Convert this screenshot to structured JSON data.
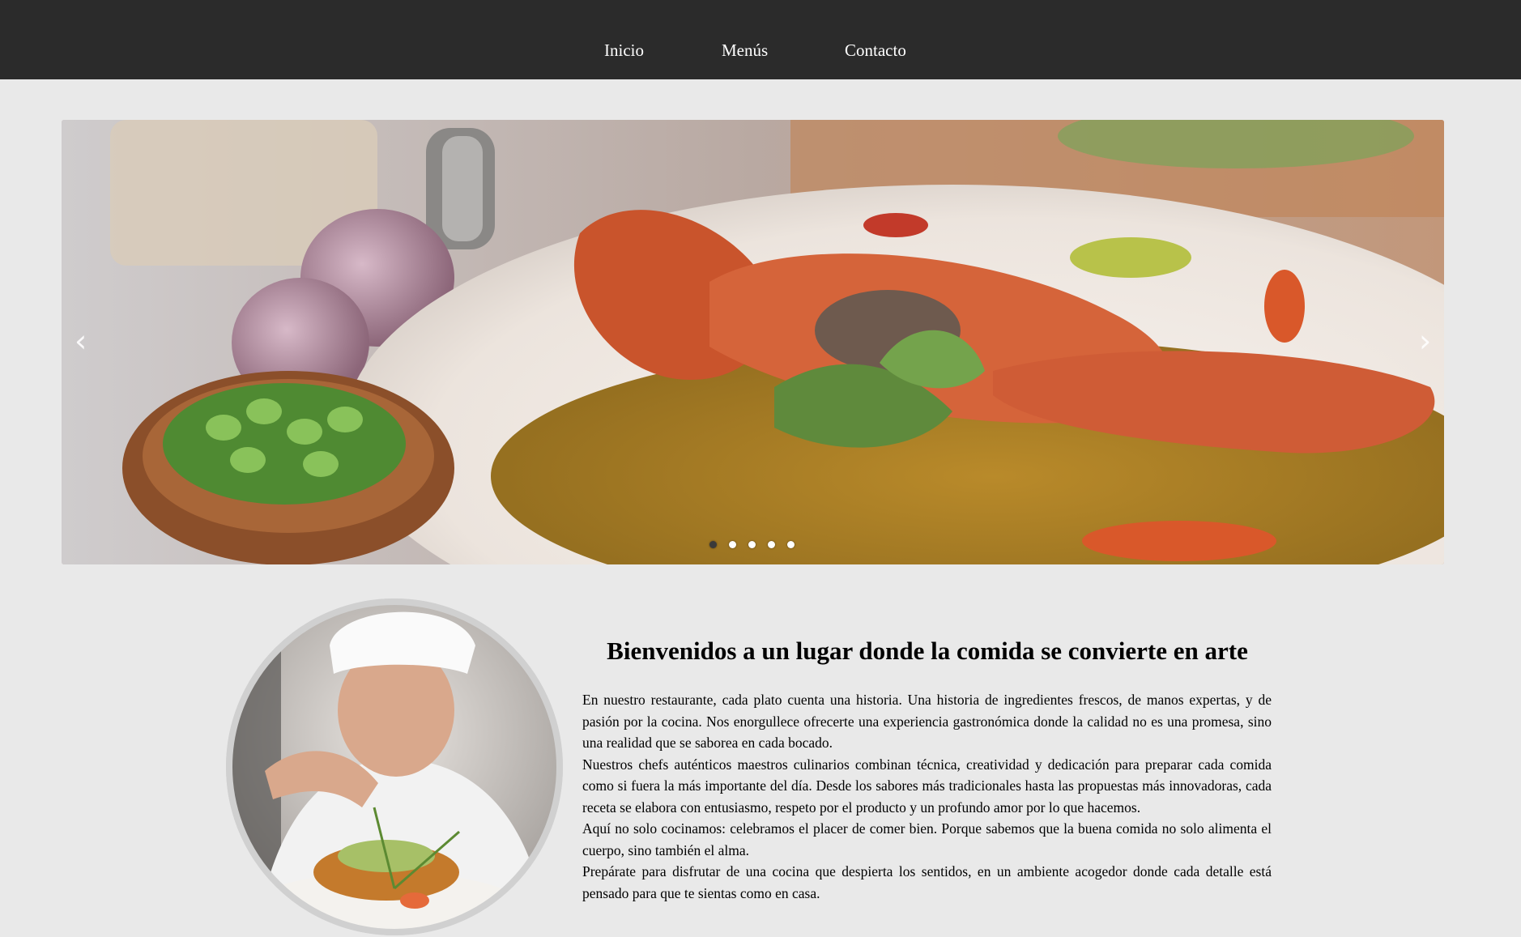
{
  "nav": {
    "items": [
      {
        "label": "Inicio"
      },
      {
        "label": "Menús"
      },
      {
        "label": "Contacto"
      }
    ]
  },
  "carousel": {
    "image": "crab-curry-dish",
    "prev_icon": "‹",
    "next_icon": "›",
    "slide_count": 5,
    "active_slide": 1
  },
  "intro": {
    "photo": "chef-plating-dish",
    "title": "Bienvenidos a un lugar donde la comida se convierte en arte",
    "paragraphs": [
      "En nuestro restaurante, cada plato cuenta una historia. Una historia de ingredientes frescos, de manos expertas, y de pasión por la cocina. Nos enorgullece ofrecerte una experiencia gastronómica donde la calidad no es una promesa, sino una realidad que se saborea en cada bocado.",
      "Nuestros chefs auténticos maestros culinarios combinan técnica, creatividad y dedicación para preparar cada comida como si fuera la más importante del día. Desde los sabores más tradicionales hasta las propuestas más innovadoras, cada receta se elabora con entusiasmo, respeto por el producto y un profundo amor por lo que hacemos.",
      "Aquí no solo cocinamos: celebramos el placer de comer bien. Porque sabemos que la buena comida no solo alimenta el cuerpo, sino también el alma.",
      "Prepárate para disfrutar de una cocina que despierta los sentidos, en un ambiente acogedor donde cada detalle está pensado para que te sientas como en casa."
    ]
  },
  "colors": {
    "navbar_bg": "#2b2b2b",
    "page_bg": "#e9e9e9",
    "nav_text": "#ffffff"
  }
}
